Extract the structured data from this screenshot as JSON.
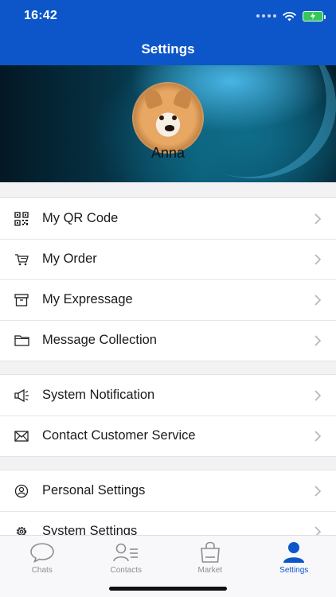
{
  "status_bar": {
    "time": "16:42"
  },
  "nav": {
    "title": "Settings"
  },
  "profile": {
    "name": "Anna"
  },
  "groups": [
    {
      "items": [
        {
          "label": "My QR Code",
          "icon": "qr-code-icon"
        },
        {
          "label": "My Order",
          "icon": "cart-icon"
        },
        {
          "label": "My Expressage",
          "icon": "box-icon"
        },
        {
          "label": "Message Collection",
          "icon": "folder-icon"
        }
      ]
    },
    {
      "items": [
        {
          "label": "System Notification",
          "icon": "megaphone-icon"
        },
        {
          "label": "Contact Customer Service",
          "icon": "envelope-icon"
        }
      ]
    },
    {
      "items": [
        {
          "label": "Personal Settings",
          "icon": "person-icon"
        },
        {
          "label": "System Settings",
          "icon": "gear-icon"
        }
      ]
    }
  ],
  "tabs": [
    {
      "label": "Chats",
      "icon": "chat-bubble-icon"
    },
    {
      "label": "Contacts",
      "icon": "contacts-icon"
    },
    {
      "label": "Market",
      "icon": "shopping-bag-icon"
    },
    {
      "label": "Settings",
      "icon": "person-filled-icon",
      "active": true
    }
  ],
  "colors": {
    "accent": "#0d56c9",
    "battery": "#34c759"
  }
}
